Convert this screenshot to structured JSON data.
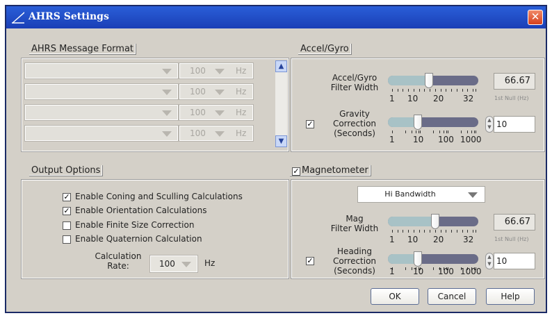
{
  "window": {
    "title": "AHRS Settings",
    "close_glyph": "✕"
  },
  "message_format": {
    "title": "AHRS Message Format",
    "rows": [
      {
        "rate": "100",
        "unit": "Hz"
      },
      {
        "rate": "100",
        "unit": "Hz"
      },
      {
        "rate": "100",
        "unit": "Hz"
      },
      {
        "rate": "100",
        "unit": "Hz"
      }
    ]
  },
  "output_options": {
    "title": "Output Options",
    "options": [
      {
        "label": "Enable Coning and Sculling Calculations",
        "checked": true,
        "mark": "✓"
      },
      {
        "label": "Enable Orientation Calculations",
        "checked": true,
        "mark": "✓"
      },
      {
        "label": "Enable Finite Size Correction",
        "checked": false,
        "mark": ""
      },
      {
        "label": "Enable Quaternion Calculation",
        "checked": false,
        "mark": ""
      }
    ],
    "rate_label_1": "Calculation",
    "rate_label_2": "Rate:",
    "rate_value": "100",
    "rate_unit": "Hz"
  },
  "accel_gyro": {
    "title": "Accel/Gyro",
    "filter_label_1": "Accel/Gyro",
    "filter_label_2": "Filter Width",
    "filter_fraction": 0.45,
    "filter_ticks": [
      "1",
      "10",
      "20",
      "32"
    ],
    "filter_value": "66.67",
    "filter_value_unit": "1st Null (Hz)",
    "gravity_checked": true,
    "gravity_mark": "✓",
    "gravity_label_1": "Gravity",
    "gravity_label_2": "Correction",
    "gravity_label_3": "(Seconds)",
    "gravity_fraction": 0.33,
    "gravity_ticks": [
      "1",
      "10",
      "100",
      "1000"
    ],
    "gravity_value": "10"
  },
  "magnetometer": {
    "title": "Magnetometer",
    "enabled": true,
    "enabled_mark": "✓",
    "bandwidth": "Hi Bandwidth",
    "filter_label_1": "Mag",
    "filter_label_2": "Filter Width",
    "filter_fraction": 0.52,
    "filter_ticks": [
      "1",
      "10",
      "20",
      "32"
    ],
    "filter_value": "66.67",
    "filter_value_unit": "1st Null (Hz)",
    "heading_checked": true,
    "heading_mark": "✓",
    "heading_label_1": "Heading",
    "heading_label_2": "Correction",
    "heading_label_3": "(Seconds)",
    "heading_fraction": 0.33,
    "heading_ticks": [
      "1",
      "10",
      "100",
      "1000"
    ],
    "heading_value": "10"
  },
  "buttons": {
    "ok": "OK",
    "cancel": "Cancel",
    "help": "Help"
  }
}
